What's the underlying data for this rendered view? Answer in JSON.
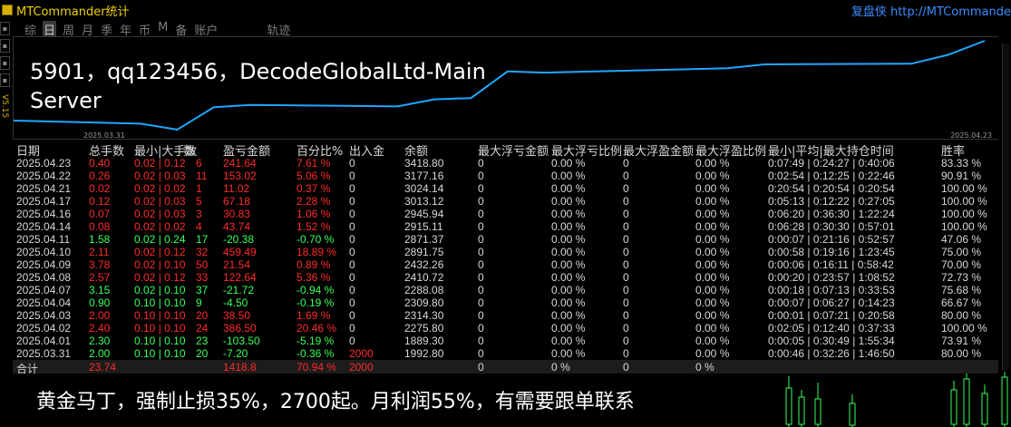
{
  "window": {
    "title": "MTCommander统计",
    "right_text": "复盘侠 http://MTCommande",
    "version": "V5.15"
  },
  "tabs": [
    {
      "label": "综",
      "active": false
    },
    {
      "label": "日",
      "active": true
    },
    {
      "label": "周",
      "active": false
    },
    {
      "label": "月",
      "active": false
    },
    {
      "label": "季",
      "active": false
    },
    {
      "label": "年",
      "active": false
    },
    {
      "label": "币",
      "active": false
    },
    {
      "label": "M",
      "active": false
    },
    {
      "label": "备",
      "active": false
    },
    {
      "label": "账户",
      "active": false
    },
    {
      "label": "轨迹",
      "active": false
    }
  ],
  "chart": {
    "overlay_text": "5901，qq123456，DecodeGlobalLtd-Main Server",
    "date_start": "2025.03.31",
    "date_end": "2025.04.23",
    "line_color": "#1ea7ff"
  },
  "chart_data": {
    "type": "line",
    "x": [
      "2025.03.31",
      "2025.04.01",
      "2025.04.02",
      "2025.04.03",
      "2025.04.04",
      "2025.04.07",
      "2025.04.08",
      "2025.04.09",
      "2025.04.10",
      "2025.04.11",
      "2025.04.14",
      "2025.04.16",
      "2025.04.17",
      "2025.04.21",
      "2025.04.22",
      "2025.04.23"
    ],
    "values": [
      1992.8,
      1889.3,
      2275.8,
      2314.3,
      2309.8,
      2288.08,
      2410.72,
      2432.26,
      2891.75,
      2871.37,
      2915.11,
      2945.94,
      3013.12,
      3024.14,
      3177.16,
      3418.8
    ],
    "xlim": [
      "2025.03.31",
      "2025.04.23"
    ]
  },
  "table": {
    "headers": [
      "日期",
      "总手数",
      "最小|大手数",
      "数",
      "盈亏金额",
      "百分比%",
      "出入金",
      "余额",
      "最大浮亏金额",
      "最大浮亏比例",
      "最大浮盈金额",
      "最大浮盈比例",
      "最小|平均|最大持仓时间",
      "胜率"
    ],
    "rows": [
      {
        "date": "2025.04.23",
        "lots": "0.40",
        "minmax": "0.02 | 0.12",
        "n": "6",
        "pnl": "241.64",
        "pct": "7.61 %",
        "dep": "0",
        "bal": "3418.80",
        "mfl": "0",
        "mflp": "0.00 %",
        "mfp": "0",
        "mfpp": "0.00 %",
        "hold": "0:07:49 | 0:24:27 | 0:40:06",
        "win": "83.33 %",
        "pos": true
      },
      {
        "date": "2025.04.22",
        "lots": "0.26",
        "minmax": "0.02 | 0.03",
        "n": "11",
        "pnl": "153.02",
        "pct": "5.06 %",
        "dep": "0",
        "bal": "3177.16",
        "mfl": "0",
        "mflp": "0.00 %",
        "mfp": "0",
        "mfpp": "0.00 %",
        "hold": "0:02:54 | 0:12:25 | 0:22:46",
        "win": "90.91 %",
        "pos": true
      },
      {
        "date": "2025.04.21",
        "lots": "0.02",
        "minmax": "0.02 | 0.02",
        "n": "1",
        "pnl": "11.02",
        "pct": "0.37 %",
        "dep": "0",
        "bal": "3024.14",
        "mfl": "0",
        "mflp": "0.00 %",
        "mfp": "0",
        "mfpp": "0.00 %",
        "hold": "0:20:54 | 0:20:54 | 0:20:54",
        "win": "100.00 %",
        "pos": true
      },
      {
        "date": "2025.04.17",
        "lots": "0.12",
        "minmax": "0.02 | 0.03",
        "n": "5",
        "pnl": "67.18",
        "pct": "2.28 %",
        "dep": "0",
        "bal": "3013.12",
        "mfl": "0",
        "mflp": "0.00 %",
        "mfp": "0",
        "mfpp": "0.00 %",
        "hold": "0:05:13 | 0:12:22 | 0:27:05",
        "win": "100.00 %",
        "pos": true
      },
      {
        "date": "2025.04.16",
        "lots": "0.07",
        "minmax": "0.02 | 0.03",
        "n": "3",
        "pnl": "30.83",
        "pct": "1.06 %",
        "dep": "0",
        "bal": "2945.94",
        "mfl": "0",
        "mflp": "0.00 %",
        "mfp": "0",
        "mfpp": "0.00 %",
        "hold": "0:06:20 | 0:36:30 | 1:22:24",
        "win": "100.00 %",
        "pos": true
      },
      {
        "date": "2025.04.14",
        "lots": "0.08",
        "minmax": "0.02 | 0.02",
        "n": "4",
        "pnl": "43.74",
        "pct": "1.52 %",
        "dep": "0",
        "bal": "2915.11",
        "mfl": "0",
        "mflp": "0.00 %",
        "mfp": "0",
        "mfpp": "0.00 %",
        "hold": "0:06:28 | 0:30:30 | 0:57:01",
        "win": "100.00 %",
        "pos": true
      },
      {
        "date": "2025.04.11",
        "lots": "1.58",
        "minmax": "0.02 | 0.24",
        "n": "17",
        "pnl": "-20.38",
        "pct": "-0.70 %",
        "dep": "0",
        "bal": "2871.37",
        "mfl": "0",
        "mflp": "0.00 %",
        "mfp": "0",
        "mfpp": "0.00 %",
        "hold": "0:00:07 | 0:21:16 | 0:52:57",
        "win": "47.06 %",
        "pos": false
      },
      {
        "date": "2025.04.10",
        "lots": "2.11",
        "minmax": "0.02 | 0.12",
        "n": "32",
        "pnl": "459.49",
        "pct": "18.89 %",
        "dep": "0",
        "bal": "2891.75",
        "mfl": "0",
        "mflp": "0.00 %",
        "mfp": "0",
        "mfpp": "0.00 %",
        "hold": "0:00:58 | 0:19:16 | 1:23:45",
        "win": "75.00 %",
        "pos": true
      },
      {
        "date": "2025.04.09",
        "lots": "3.78",
        "minmax": "0.02 | 0.10",
        "n": "50",
        "pnl": "21.54",
        "pct": "0.89 %",
        "dep": "0",
        "bal": "2432.26",
        "mfl": "0",
        "mflp": "0.00 %",
        "mfp": "0",
        "mfpp": "0.00 %",
        "hold": "0:00:06 | 0:16:11 | 0:58:42",
        "win": "70.00 %",
        "pos": true
      },
      {
        "date": "2025.04.08",
        "lots": "2.57",
        "minmax": "0.02 | 0.12",
        "n": "33",
        "pnl": "122.64",
        "pct": "5.36 %",
        "dep": "0",
        "bal": "2410.72",
        "mfl": "0",
        "mflp": "0.00 %",
        "mfp": "0",
        "mfpp": "0.00 %",
        "hold": "0:00:20 | 0:23:57 | 1:08:52",
        "win": "72.73 %",
        "pos": true
      },
      {
        "date": "2025.04.07",
        "lots": "3.15",
        "minmax": "0.02 | 0.10",
        "n": "37",
        "pnl": "-21.72",
        "pct": "-0.94 %",
        "dep": "0",
        "bal": "2288.08",
        "mfl": "0",
        "mflp": "0.00 %",
        "mfp": "0",
        "mfpp": "0.00 %",
        "hold": "0:00:18 | 0:07:13 | 0:33:53",
        "win": "75.68 %",
        "pos": false
      },
      {
        "date": "2025.04.04",
        "lots": "0.90",
        "minmax": "0.10 | 0.10",
        "n": "9",
        "pnl": "-4.50",
        "pct": "-0.19 %",
        "dep": "0",
        "bal": "2309.80",
        "mfl": "0",
        "mflp": "0.00 %",
        "mfp": "0",
        "mfpp": "0.00 %",
        "hold": "0:00:07 | 0:06:27 | 0:14:23",
        "win": "66.67 %",
        "pos": false
      },
      {
        "date": "2025.04.03",
        "lots": "2.00",
        "minmax": "0.10 | 0.10",
        "n": "20",
        "pnl": "38.50",
        "pct": "1.69 %",
        "dep": "0",
        "bal": "2314.30",
        "mfl": "0",
        "mflp": "0.00 %",
        "mfp": "0",
        "mfpp": "0.00 %",
        "hold": "0:00:01 | 0:07:21 | 0:20:58",
        "win": "80.00 %",
        "pos": true
      },
      {
        "date": "2025.04.02",
        "lots": "2.40",
        "minmax": "0.10 | 0.10",
        "n": "24",
        "pnl": "386.50",
        "pct": "20.46 %",
        "dep": "0",
        "bal": "2275.80",
        "mfl": "0",
        "mflp": "0.00 %",
        "mfp": "0",
        "mfpp": "0.00 %",
        "hold": "0:02:05 | 0:12:40 | 0:37:33",
        "win": "100.00 %",
        "pos": true
      },
      {
        "date": "2025.04.01",
        "lots": "2.30",
        "minmax": "0.10 | 0.10",
        "n": "23",
        "pnl": "-103.50",
        "pct": "-5.19 %",
        "dep": "0",
        "bal": "1889.30",
        "mfl": "0",
        "mflp": "0.00 %",
        "mfp": "0",
        "mfpp": "0.00 %",
        "hold": "0:00:05 | 0:30:49 | 1:55:34",
        "win": "73.91 %",
        "pos": false
      },
      {
        "date": "2025.03.31",
        "lots": "2.00",
        "minmax": "0.10 | 0.10",
        "n": "20",
        "pnl": "-7.20",
        "pct": "-0.36 %",
        "dep": "2000",
        "bal": "1992.80",
        "mfl": "0",
        "mflp": "0.00 %",
        "mfp": "0",
        "mfpp": "0.00 %",
        "hold": "0:00:46 | 0:32:26 | 1:46:50",
        "win": "80.00 %",
        "pos": false
      }
    ],
    "total": {
      "label": "合计",
      "lots": "23.74",
      "pnl": "1418.8",
      "pct": "70.94 %",
      "dep": "2000",
      "mfl": "0",
      "mflp": "0 %",
      "mfp": "0",
      "mfpp": "0 %"
    }
  },
  "footer": {
    "message": "黄金马丁，强制止损35%，2700起。月利润55%，有需要跟单联系"
  },
  "colors": {
    "positive": "#ff2a2a",
    "negative": "#39ff5a",
    "title": "#f0d000",
    "link": "#3a8cff"
  }
}
